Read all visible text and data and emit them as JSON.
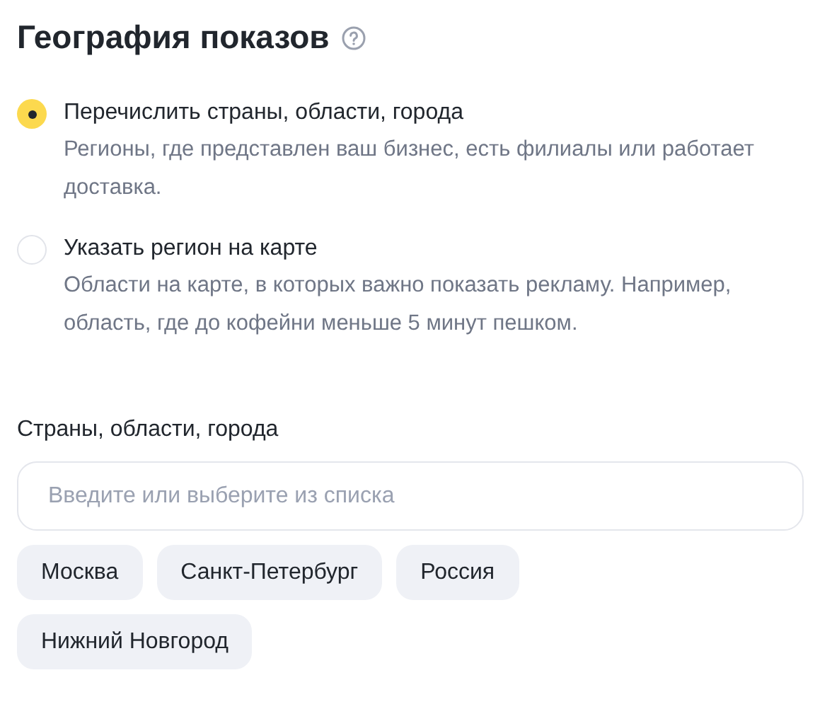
{
  "title": "География показов",
  "options": [
    {
      "label": "Перечислить страны, области, города",
      "description": "Регионы, где представлен ваш бизнес, есть филиалы или работает доставка.",
      "selected": true
    },
    {
      "label": "Указать регион на карте",
      "description": "Области на карте, в которых важно показать рекламу. Например, область, где до кофейни меньше 5 минут пешком.",
      "selected": false
    }
  ],
  "regions_field": {
    "label": "Страны, области, города",
    "placeholder": "Введите или выберите из списка"
  },
  "chips": [
    {
      "label": "Москва"
    },
    {
      "label": "Санкт-Петербург"
    },
    {
      "label": "Россия"
    },
    {
      "label": "Нижний Новгород"
    }
  ]
}
